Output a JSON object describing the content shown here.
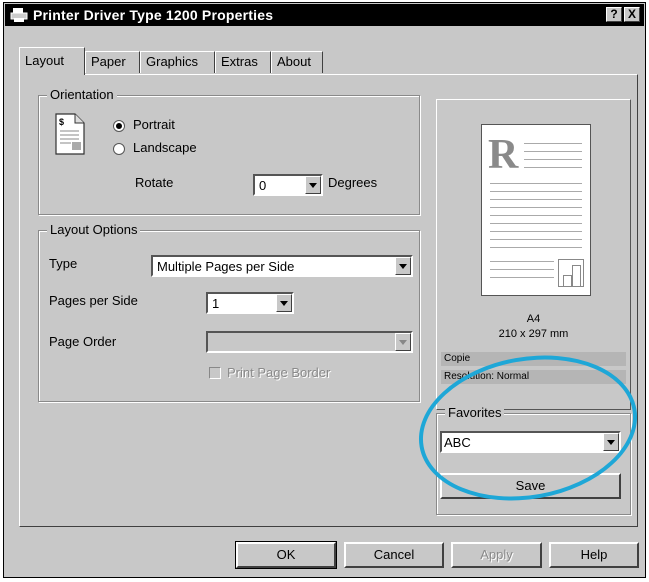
{
  "window": {
    "title": "Printer Driver Type 1200 Properties",
    "help_button": "?",
    "close_button": "X"
  },
  "tabs": [
    "Layout",
    "Paper",
    "Graphics",
    "Extras",
    "About"
  ],
  "active_tab": "Layout",
  "orientation": {
    "group_label": "Orientation",
    "portrait_label": "Portrait",
    "landscape_label": "Landscape",
    "selected": "Portrait",
    "rotate_label": "Rotate",
    "rotate_value": "0",
    "degrees_label": "Degrees"
  },
  "layout_options": {
    "group_label": "Layout Options",
    "type_label": "Type",
    "type_value": "Multiple Pages per Side",
    "pages_per_side_label": "Pages per Side",
    "pages_per_side_value": "1",
    "page_order_label": "Page Order",
    "page_order_value": "",
    "print_page_border_label": "Print Page Border"
  },
  "preview": {
    "paper_size": "A4",
    "dimensions": "210 x 297 mm",
    "copies_label": "Copie",
    "resolution_label": "Resolution: Normal"
  },
  "favorites": {
    "group_label": "Favorites",
    "value": "ABC",
    "save_label": "Save"
  },
  "buttons": {
    "ok": "OK",
    "cancel": "Cancel",
    "apply": "Apply",
    "help": "Help"
  },
  "colors": {
    "dialog_bg": "#c8c8c8",
    "titlebar_bg": "#000000",
    "highlight_circle": "#1ea7d7"
  }
}
